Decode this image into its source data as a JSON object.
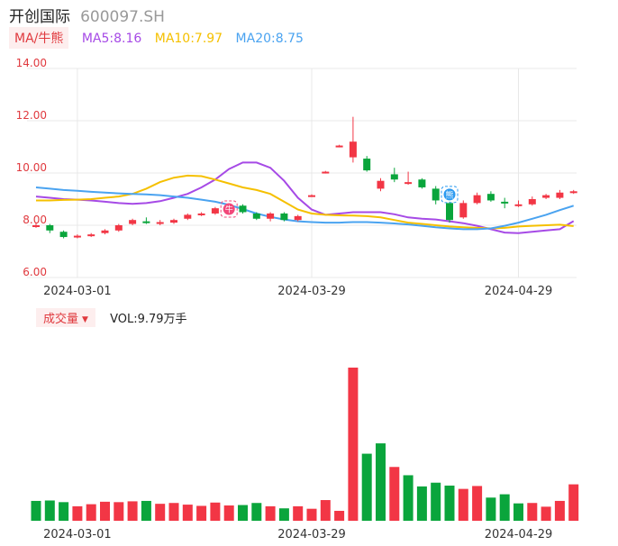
{
  "header": {
    "name": "开创国际",
    "code": "600097.SH"
  },
  "ma_legend": {
    "type_label": "MA/牛熊",
    "items": [
      {
        "label": "MA5:8.16",
        "color": "#a64ae6"
      },
      {
        "label": "MA10:7.97",
        "color": "#f5c000"
      },
      {
        "label": "MA20:8.75",
        "color": "#4aa3f0"
      }
    ]
  },
  "volume_legend": {
    "type_label": "成交量",
    "value_label": "VOL:9.79万手"
  },
  "colors": {
    "up": "#f23645",
    "down": "#0aa53c",
    "grid": "#e8e8e8",
    "axis_label": "#e0393e"
  },
  "markers": [
    {
      "label": "牛",
      "index": 14,
      "color": "#f2487a"
    },
    {
      "label": "熊",
      "index": 30,
      "color": "#2c9af0"
    }
  ],
  "chart_data": [
    {
      "type": "candlestick",
      "ylim": [
        6.0,
        14.0
      ],
      "yticks": [
        "14.00",
        "12.00",
        "10.00",
        "8.00",
        "6.00"
      ],
      "x_tick_labels": [
        {
          "label": "2024-03-01",
          "index": 3
        },
        {
          "label": "2024-03-29",
          "index": 20
        },
        {
          "label": "2024-04-29",
          "index": 35
        }
      ],
      "candles": [
        {
          "o": 8.0,
          "c": 8.0,
          "h": 8.1,
          "l": 7.9,
          "d": "flat"
        },
        {
          "o": 8.0,
          "c": 7.8,
          "h": 8.05,
          "l": 7.7,
          "d": "down"
        },
        {
          "o": 7.75,
          "c": 7.55,
          "h": 7.8,
          "l": 7.5,
          "d": "down"
        },
        {
          "o": 7.55,
          "c": 7.6,
          "h": 7.65,
          "l": 7.5,
          "d": "up"
        },
        {
          "o": 7.6,
          "c": 7.65,
          "h": 7.7,
          "l": 7.55,
          "d": "up"
        },
        {
          "o": 7.7,
          "c": 7.8,
          "h": 7.85,
          "l": 7.65,
          "d": "up"
        },
        {
          "o": 7.8,
          "c": 8.0,
          "h": 8.05,
          "l": 7.75,
          "d": "up"
        },
        {
          "o": 8.05,
          "c": 8.2,
          "h": 8.25,
          "l": 8.0,
          "d": "up"
        },
        {
          "o": 8.15,
          "c": 8.1,
          "h": 8.3,
          "l": 8.05,
          "d": "down"
        },
        {
          "o": 8.1,
          "c": 8.12,
          "h": 8.2,
          "l": 8.0,
          "d": "up"
        },
        {
          "o": 8.1,
          "c": 8.2,
          "h": 8.25,
          "l": 8.05,
          "d": "up"
        },
        {
          "o": 8.25,
          "c": 8.4,
          "h": 8.45,
          "l": 8.2,
          "d": "up"
        },
        {
          "o": 8.4,
          "c": 8.45,
          "h": 8.5,
          "l": 8.35,
          "d": "up"
        },
        {
          "o": 8.45,
          "c": 8.65,
          "h": 8.7,
          "l": 8.4,
          "d": "up"
        },
        {
          "o": 8.62,
          "c": 8.7,
          "h": 8.75,
          "l": 8.55,
          "d": "up"
        },
        {
          "o": 8.75,
          "c": 8.5,
          "h": 8.8,
          "l": 8.45,
          "d": "down"
        },
        {
          "o": 8.45,
          "c": 8.25,
          "h": 8.5,
          "l": 8.2,
          "d": "down"
        },
        {
          "o": 8.25,
          "c": 8.45,
          "h": 8.5,
          "l": 8.15,
          "d": "up"
        },
        {
          "o": 8.45,
          "c": 8.2,
          "h": 8.5,
          "l": 8.15,
          "d": "down"
        },
        {
          "o": 8.2,
          "c": 8.35,
          "h": 8.4,
          "l": 8.15,
          "d": "up"
        },
        {
          "o": 9.1,
          "c": 9.15,
          "h": 9.18,
          "l": 9.08,
          "d": "up"
        },
        {
          "o": 10.0,
          "c": 10.05,
          "h": 10.08,
          "l": 9.98,
          "d": "up"
        },
        {
          "o": 11.0,
          "c": 11.05,
          "h": 11.08,
          "l": 10.98,
          "d": "up"
        },
        {
          "o": 10.6,
          "c": 11.2,
          "h": 12.15,
          "l": 10.4,
          "d": "up"
        },
        {
          "o": 10.55,
          "c": 10.1,
          "h": 10.65,
          "l": 10.05,
          "d": "down"
        },
        {
          "o": 9.4,
          "c": 9.7,
          "h": 9.8,
          "l": 9.3,
          "d": "up"
        },
        {
          "o": 9.95,
          "c": 9.75,
          "h": 10.2,
          "l": 9.65,
          "d": "down"
        },
        {
          "o": 9.6,
          "c": 9.65,
          "h": 10.05,
          "l": 9.55,
          "d": "up"
        },
        {
          "o": 9.75,
          "c": 9.45,
          "h": 9.8,
          "l": 9.4,
          "d": "down"
        },
        {
          "o": 9.4,
          "c": 8.95,
          "h": 9.5,
          "l": 8.8,
          "d": "down"
        },
        {
          "o": 8.85,
          "c": 8.2,
          "h": 8.9,
          "l": 8.1,
          "d": "down"
        },
        {
          "o": 8.3,
          "c": 8.85,
          "h": 8.95,
          "l": 8.25,
          "d": "up"
        },
        {
          "o": 8.85,
          "c": 9.15,
          "h": 9.25,
          "l": 8.8,
          "d": "up"
        },
        {
          "o": 9.2,
          "c": 8.95,
          "h": 9.3,
          "l": 8.9,
          "d": "down"
        },
        {
          "o": 8.9,
          "c": 8.85,
          "h": 9.05,
          "l": 8.65,
          "d": "down"
        },
        {
          "o": 8.75,
          "c": 8.8,
          "h": 8.95,
          "l": 8.7,
          "d": "up"
        },
        {
          "o": 8.8,
          "c": 9.0,
          "h": 9.1,
          "l": 8.75,
          "d": "up"
        },
        {
          "o": 9.05,
          "c": 9.15,
          "h": 9.2,
          "l": 9.0,
          "d": "up"
        },
        {
          "o": 9.05,
          "c": 9.25,
          "h": 9.35,
          "l": 9.0,
          "d": "up"
        },
        {
          "o": 9.25,
          "c": 9.3,
          "h": 9.35,
          "l": 9.2,
          "d": "up"
        }
      ],
      "series": [
        {
          "name": "MA5",
          "color": "#a64ae6",
          "values": [
            9.1,
            9.05,
            9.0,
            8.98,
            8.95,
            8.9,
            8.85,
            8.82,
            8.85,
            8.92,
            9.05,
            9.2,
            9.45,
            9.75,
            10.15,
            10.4,
            10.4,
            10.2,
            9.7,
            9.05,
            8.6,
            8.4,
            8.45,
            8.5,
            8.5,
            8.5,
            8.42,
            8.3,
            8.25,
            8.22,
            8.15,
            8.08,
            7.98,
            7.85,
            7.72,
            7.7,
            7.75,
            7.8,
            7.85,
            8.16
          ]
        },
        {
          "name": "MA10",
          "color": "#f5c000",
          "values": [
            8.95,
            8.95,
            8.97,
            8.98,
            9.0,
            9.05,
            9.1,
            9.2,
            9.4,
            9.65,
            9.82,
            9.9,
            9.88,
            9.75,
            9.6,
            9.45,
            9.35,
            9.2,
            8.9,
            8.6,
            8.45,
            8.4,
            8.38,
            8.37,
            8.35,
            8.3,
            8.2,
            8.1,
            8.05,
            8.0,
            7.95,
            7.92,
            7.9,
            7.88,
            7.9,
            7.95,
            7.98,
            8.0,
            8.02,
            7.97
          ]
        },
        {
          "name": "MA20",
          "color": "#4aa3f0",
          "values": [
            9.45,
            9.4,
            9.35,
            9.32,
            9.28,
            9.25,
            9.22,
            9.2,
            9.18,
            9.15,
            9.1,
            9.05,
            8.98,
            8.9,
            8.78,
            8.62,
            8.45,
            8.32,
            8.22,
            8.15,
            8.12,
            8.1,
            8.1,
            8.12,
            8.12,
            8.1,
            8.07,
            8.03,
            7.98,
            7.92,
            7.88,
            7.85,
            7.85,
            7.88,
            7.98,
            8.1,
            8.25,
            8.4,
            8.58,
            8.75
          ]
        }
      ]
    },
    {
      "type": "bar",
      "name": "成交量",
      "unit": "万手",
      "x_tick_labels": [
        {
          "label": "2024-03-01",
          "index": 3
        },
        {
          "label": "2024-03-29",
          "index": 20
        },
        {
          "label": "2024-04-29",
          "index": 35
        }
      ],
      "values": [
        {
          "v": 4.8,
          "d": "down"
        },
        {
          "v": 4.9,
          "d": "down"
        },
        {
          "v": 4.5,
          "d": "down"
        },
        {
          "v": 3.5,
          "d": "up"
        },
        {
          "v": 4.0,
          "d": "up"
        },
        {
          "v": 4.6,
          "d": "up"
        },
        {
          "v": 4.5,
          "d": "up"
        },
        {
          "v": 4.7,
          "d": "up"
        },
        {
          "v": 4.8,
          "d": "down"
        },
        {
          "v": 4.1,
          "d": "up"
        },
        {
          "v": 4.3,
          "d": "up"
        },
        {
          "v": 3.9,
          "d": "up"
        },
        {
          "v": 3.6,
          "d": "up"
        },
        {
          "v": 4.4,
          "d": "up"
        },
        {
          "v": 3.7,
          "d": "up"
        },
        {
          "v": 3.8,
          "d": "down"
        },
        {
          "v": 4.3,
          "d": "down"
        },
        {
          "v": 3.5,
          "d": "up"
        },
        {
          "v": 3.0,
          "d": "down"
        },
        {
          "v": 3.5,
          "d": "up"
        },
        {
          "v": 2.9,
          "d": "up"
        },
        {
          "v": 5.0,
          "d": "up"
        },
        {
          "v": 2.4,
          "d": "up"
        },
        {
          "v": 37.0,
          "d": "up"
        },
        {
          "v": 16.2,
          "d": "down"
        },
        {
          "v": 18.7,
          "d": "down"
        },
        {
          "v": 13.0,
          "d": "up"
        },
        {
          "v": 11.0,
          "d": "down"
        },
        {
          "v": 8.3,
          "d": "down"
        },
        {
          "v": 9.2,
          "d": "down"
        },
        {
          "v": 8.5,
          "d": "down"
        },
        {
          "v": 7.7,
          "d": "up"
        },
        {
          "v": 8.4,
          "d": "up"
        },
        {
          "v": 5.6,
          "d": "down"
        },
        {
          "v": 6.4,
          "d": "down"
        },
        {
          "v": 4.2,
          "d": "down"
        },
        {
          "v": 4.3,
          "d": "up"
        },
        {
          "v": 3.4,
          "d": "up"
        },
        {
          "v": 4.8,
          "d": "up"
        },
        {
          "v": 8.8,
          "d": "up"
        }
      ]
    }
  ]
}
